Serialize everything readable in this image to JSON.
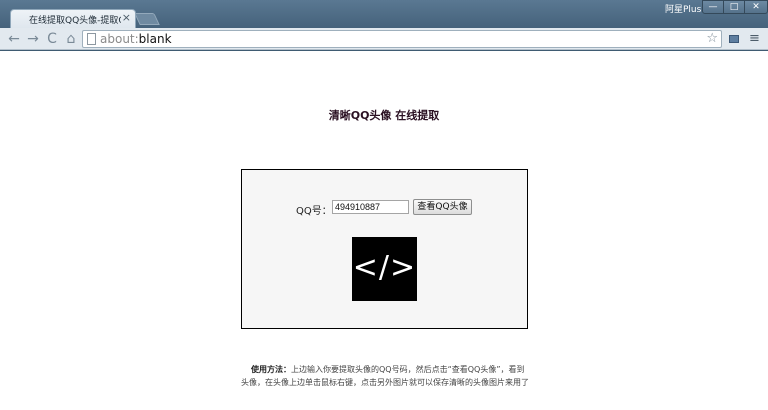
{
  "browser": {
    "tab_title": "在线提取QQ头像-提取QQ头",
    "tab_close": "×",
    "profile_name": "阿星Plus",
    "window_buttons": {
      "minimize": "—",
      "maximize": "□",
      "close": "✕"
    },
    "icons": {
      "back": "←",
      "forward": "→",
      "reload": "C",
      "home": "⌂",
      "star": "☆",
      "menu": "≡"
    },
    "url": {
      "scheme": "about:",
      "rest": "blank"
    }
  },
  "page": {
    "title": "清晰QQ头像 在线提取",
    "form": {
      "qq_label": "QQ号：",
      "qq_value": "494910887",
      "view_button": "查看QQ头像"
    },
    "avatar_glyph": "</>",
    "usage": {
      "heading": "使用方法：",
      "text": "上边输入你要提取头像的QQ号码，然后点击“查看QQ头像”，看到头像，在头像上边单击鼠标右键，点击另外图片就可以保存清晰的头像图片来用了"
    }
  },
  "colors": {
    "chrome_frame": "#3f5b72",
    "panel_background": "#f6f6f6",
    "title_color": "#2a1022"
  }
}
